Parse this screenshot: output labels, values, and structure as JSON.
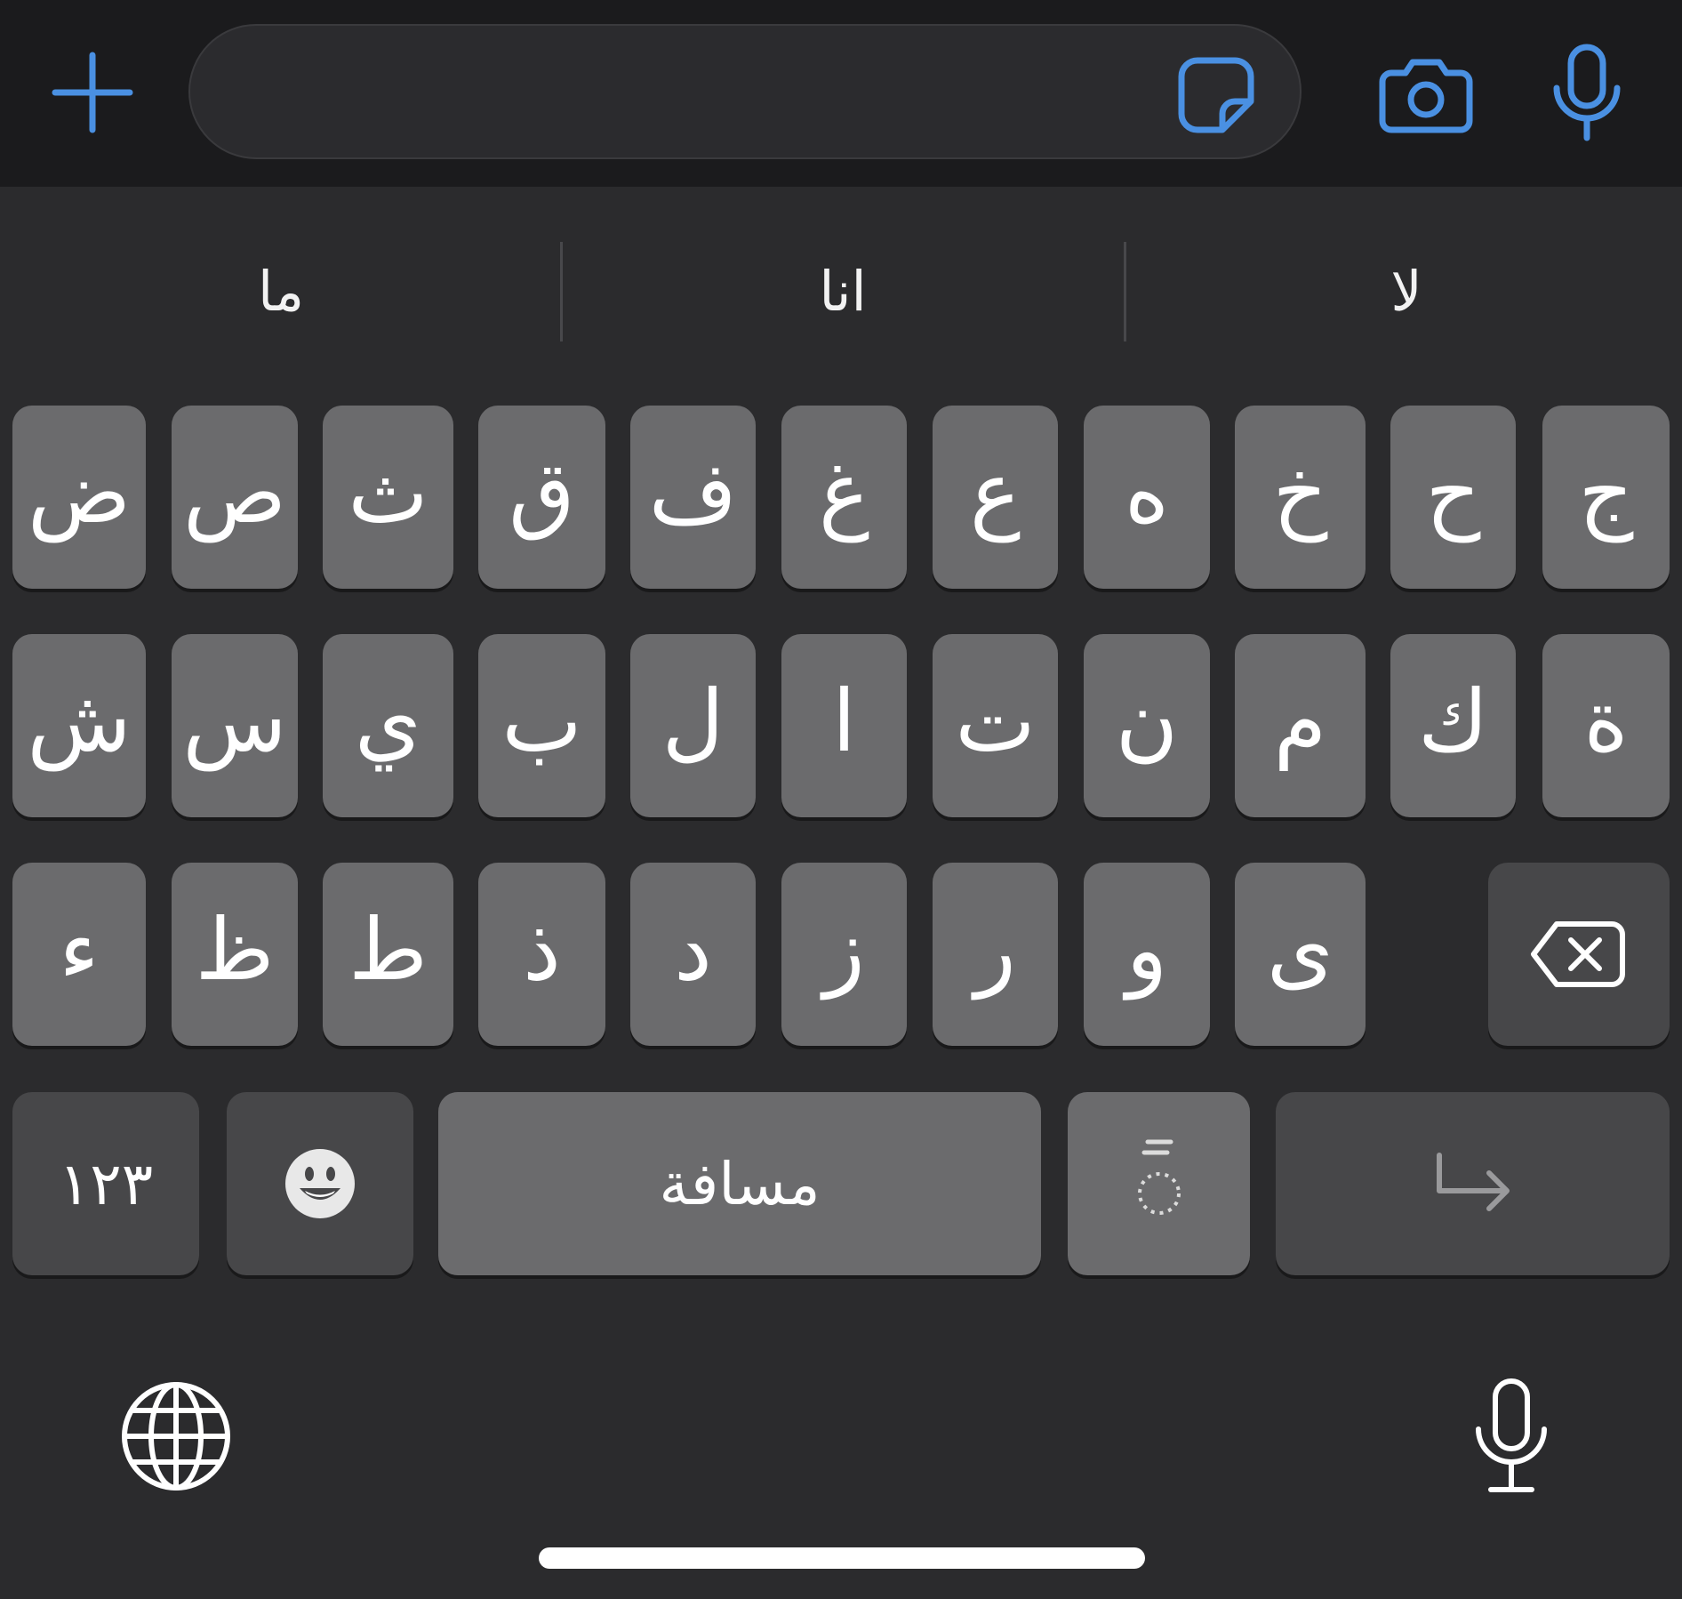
{
  "composer": {
    "placeholder": "",
    "accent": "#4a90e2",
    "icons": [
      "plus-icon",
      "sticker-icon",
      "camera-icon",
      "microphone-icon"
    ]
  },
  "suggestions": [
    "ما",
    "انا",
    "لا"
  ],
  "keyboard": {
    "row1": [
      "ض",
      "ص",
      "ث",
      "ق",
      "ف",
      "غ",
      "ع",
      "ه",
      "خ",
      "ح",
      "ج"
    ],
    "row2": [
      "ش",
      "س",
      "ي",
      "ب",
      "ل",
      "ا",
      "ت",
      "ن",
      "م",
      "ك",
      "ة"
    ],
    "row3": [
      "ء",
      "ظ",
      "ط",
      "ذ",
      "د",
      "ز",
      "ر",
      "و",
      "ى"
    ],
    "numbers_label": "١٢٣",
    "space_label": "مسافة",
    "diacritic_label": "ً",
    "icons": [
      "delete-icon",
      "emoji-icon",
      "return-icon",
      "globe-icon",
      "microphone-icon"
    ]
  },
  "colors": {
    "background": "#2b2b2d",
    "key": "#6b6b6d",
    "key_dark": "#474749",
    "top_bar": "#1b1b1d"
  }
}
